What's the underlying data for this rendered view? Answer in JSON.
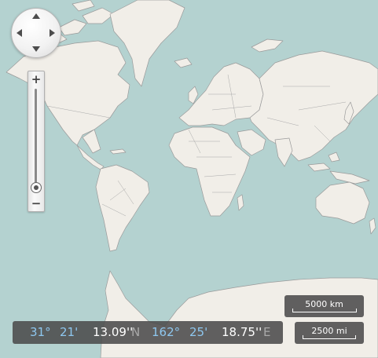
{
  "map": {
    "style": "world-map",
    "ocean_color": "#b4d2d0",
    "land_color": "#f1eee8",
    "border_color": "#9a9a9a"
  },
  "navigator": {
    "up_icon": "triangle-up-icon",
    "down_icon": "triangle-down-icon",
    "left_icon": "triangle-left-icon",
    "right_icon": "triangle-right-icon"
  },
  "zoom": {
    "in_label": "+",
    "out_label": "−",
    "level_fraction": 0.1
  },
  "coordinates": {
    "lat_deg": "31°",
    "lat_min": "21'",
    "lat_sec": "13.09''",
    "lat_hemi": "N",
    "lon_deg": "162°",
    "lon_min": "25'",
    "lon_sec": "18.75''",
    "lon_hemi": "E"
  },
  "scale": {
    "km_label": "5000 km",
    "mi_label": "2500 mi"
  }
}
